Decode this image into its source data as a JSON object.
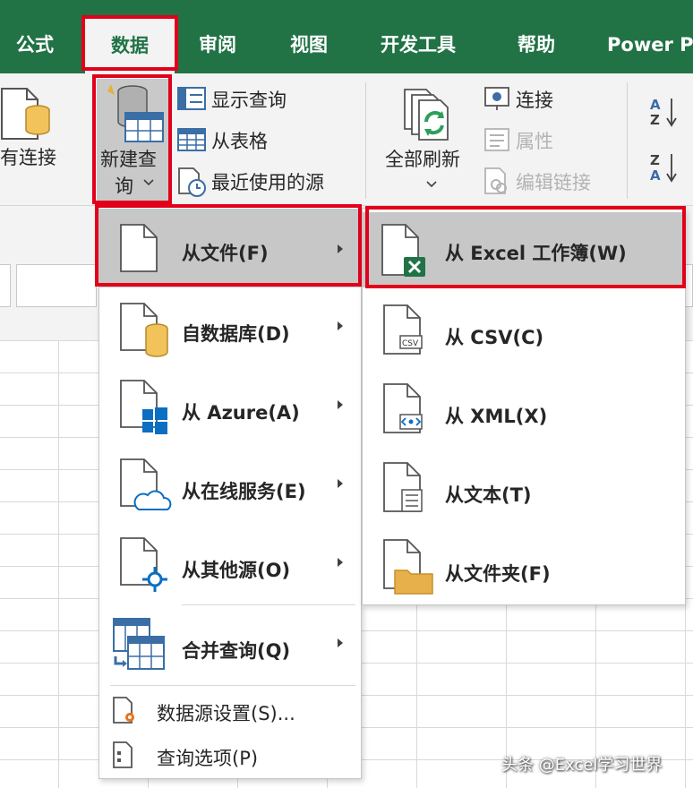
{
  "ribbon_tabs": {
    "formula": "公式",
    "data": "数据",
    "review": "审阅",
    "view": "视图",
    "developer": "开发工具",
    "help": "帮助",
    "power": "Power P"
  },
  "ribbon": {
    "existing_connections": "有连接",
    "new_query_line1": "新建查",
    "new_query_line2": "询",
    "show_queries": "显示查询",
    "from_table": "从表格",
    "recent_sources": "最近使用的源",
    "refresh_all": "全部刷新",
    "connections": "连接",
    "properties": "属性",
    "edit_links": "编辑链接",
    "sort_az_top": "A",
    "sort_az_bottom": "Z",
    "sort_za_top": "Z",
    "sort_za_bottom": "A"
  },
  "new_query_menu": {
    "from_file": "从文件(F)",
    "from_database": "自数据库(D)",
    "from_azure": "从 Azure(A)",
    "from_online": "从在线服务(E)",
    "from_other": "从其他源(O)",
    "combine": "合并查询(Q)",
    "data_source_settings": "数据源设置(S)...",
    "query_options": "查询选项(P)"
  },
  "from_file_submenu": {
    "from_excel": "从 Excel 工作簿(W)",
    "from_csv": "从 CSV(C)",
    "from_xml": "从 XML(X)",
    "from_text": "从文本(T)",
    "from_folder": "从文件夹(F)"
  },
  "watermark": "头条 @Excel学习世界",
  "colors": {
    "excel_green": "#217346",
    "highlight_red": "#e2001a",
    "menu_hover": "#c7c7c7",
    "folder_yellow": "#e8b04a",
    "azure_blue": "#0a6ec2"
  }
}
